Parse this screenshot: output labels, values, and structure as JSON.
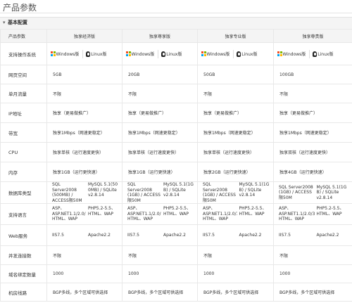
{
  "page": {
    "title": "产品参数"
  },
  "section": {
    "label": "基本配置"
  },
  "table": {
    "header": {
      "label": "产品参数",
      "plans": [
        "独享经济版",
        "独享尊享版",
        "独享专业版",
        "独享尊贵版"
      ]
    },
    "os": {
      "label": "支持操作系统",
      "windows": "Windows版",
      "linux": "Linux版",
      "icons": [
        "windows-icon",
        "linux-icon"
      ],
      "colors": {
        "win_red": "#f25022",
        "win_green": "#7fba00",
        "win_blue": "#00a4ef",
        "win_yellow": "#ffb900"
      }
    },
    "rows": [
      {
        "key": "space",
        "label": "网页空间",
        "values": [
          "5GB",
          "20GB",
          "50GB",
          "100GB"
        ]
      },
      {
        "key": "traffic",
        "label": "单月流量",
        "values": [
          "不限",
          "不限",
          "不限",
          "不限"
        ]
      },
      {
        "key": "ip",
        "label": "IP地址",
        "values": [
          "独享（更易做推广）",
          "独享（更易做推广）",
          "独享（更易做推广）",
          "独享（更易做推广）"
        ]
      },
      {
        "key": "bandwidth",
        "label": "带宽",
        "values": [
          "独享1Mbps（网速更稳定）",
          "独享1Mbps（网速更稳定）",
          "独享1Mbps（网速更稳定）",
          "独享1Mbps（网速更稳定）"
        ]
      },
      {
        "key": "cpu",
        "label": "CPU",
        "values": [
          "独享单核（运行速度更快）",
          "独享单核（运行速度更快）",
          "独享单核（运行速度更快）",
          "独享双核（运行速度更快）"
        ]
      },
      {
        "key": "memory",
        "label": "内存",
        "values": [
          "独享1GB（运行更快速）",
          "独享1GB（运行更快速）",
          "独享2GB（运行更快速）",
          "独享4GB（运行更快速）"
        ]
      }
    ],
    "db": {
      "label": "数据库类型",
      "plans": [
        {
          "a": "SQL Server2008 (500MB) / ACCESS限50M",
          "b": "MySQL 5.1(50 0MB) / SQLite v2.8.14"
        },
        {
          "a": "SQL Server2008 (1GB) / ACCESS限50M",
          "b": "MySQL 5.1(1G B) / SQLite v2.8.14"
        },
        {
          "a": "SQL Server2008 (1GB) / ACCESS限50M",
          "b": "MySQL 5.1(1G B) / SQLite v2.8.14"
        },
        {
          "a": "SQL Server2008 (1GB) / ACCESS限50M",
          "b": "MySQL 5.1(1G B) / SQLite v2.8.14"
        }
      ]
    },
    "lang": {
      "label": "支持语言",
      "plans": [
        {
          "a": "ASP、ASP.NET1.1/2.0/3.5/4.0/4.5 HTML、WAP",
          "b": "PHP5.2-5.5、HTML、WAP"
        },
        {
          "a": "ASP、ASP.NET1.1/2.0/3.5/4.0/4.5 HTML、WAP",
          "b": "PHP5.2-5.5、HTML、WAP"
        },
        {
          "a": "ASP、ASP.NET1.1/2.0/3.5/4.0/4.5 HTML、WAP",
          "b": "PHP5.2-5.5、HTML、WAP"
        },
        {
          "a": "ASP、ASP.NET1.1/2.0/3.5/4.0/4.5 HTML、WAP",
          "b": "PHP5.2-5.5、HTML、WAP"
        }
      ]
    },
    "web": {
      "label": "Web服务",
      "plans": [
        {
          "a": "IIS7.5",
          "b": "Apache2.2"
        },
        {
          "a": "IIS7.5",
          "b": "Apache2.2"
        },
        {
          "a": "IIS7.5",
          "b": "Apache2.2"
        },
        {
          "a": "IIS7.5",
          "b": "Apache2.2"
        }
      ]
    },
    "rows2": [
      {
        "key": "concurrency",
        "label": "并发连接数",
        "values": [
          "不限",
          "不限",
          "不限",
          "不限"
        ]
      },
      {
        "key": "domains",
        "label": "域名绑定数量",
        "values": [
          "1000",
          "1000",
          "1000",
          "1000"
        ]
      },
      {
        "key": "datacenter",
        "label": "机房线路",
        "values": [
          "BGP多线，多个区域可供选择",
          "BGP多线，多个区域可供选择",
          "BGP多线，多个区域可供选择",
          "BGP多线，多个区域可供选择"
        ]
      }
    ]
  }
}
